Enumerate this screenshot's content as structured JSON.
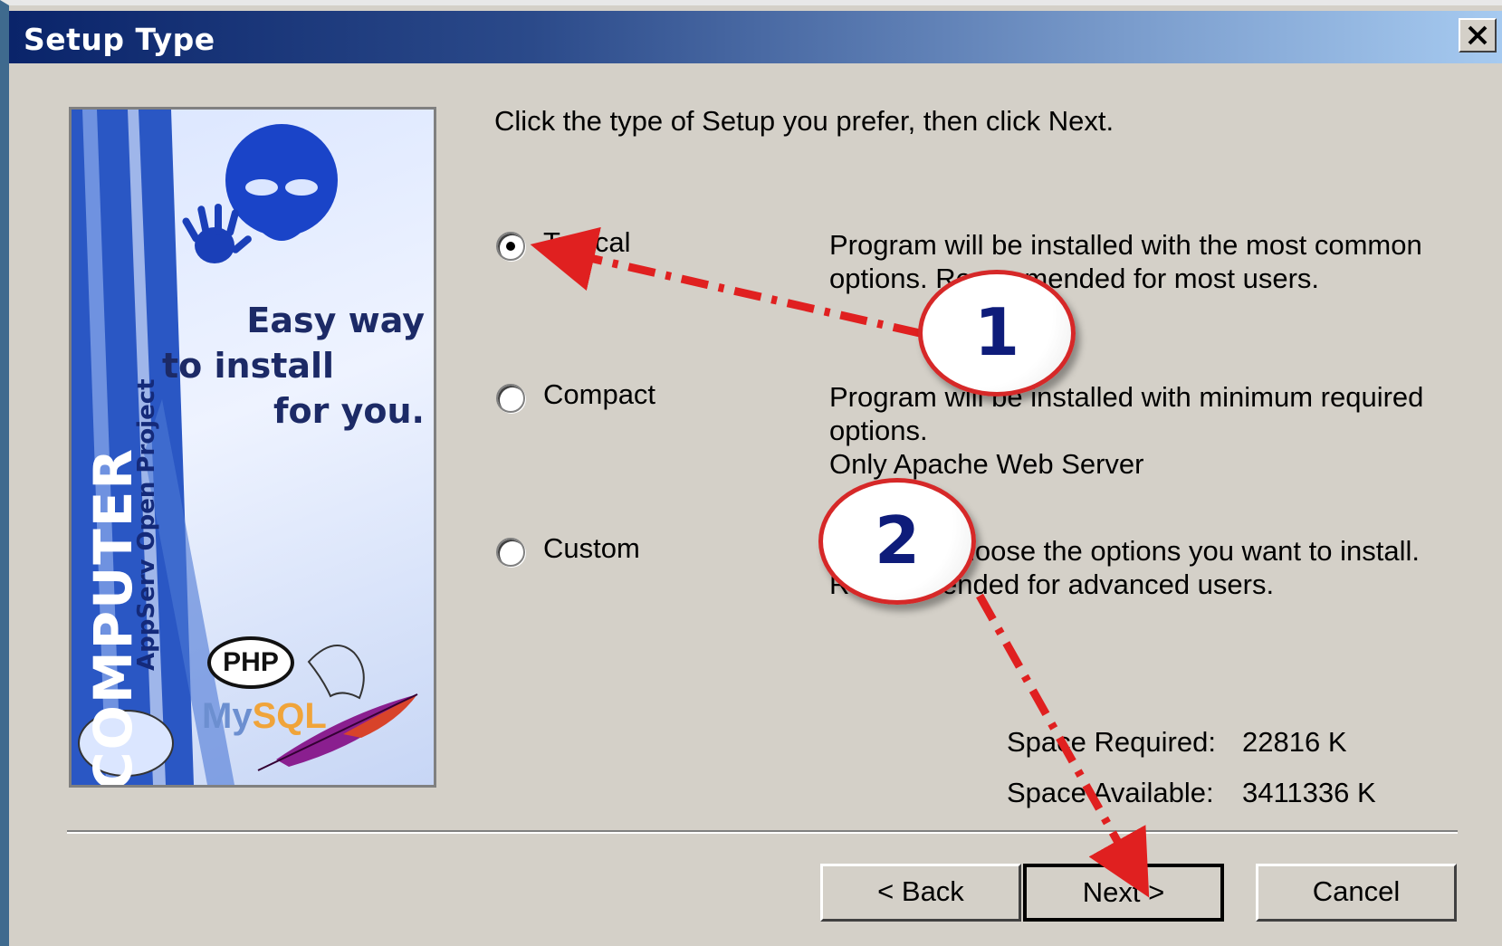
{
  "window": {
    "title": "Setup Type"
  },
  "banner": {
    "slogan_lines": [
      "Easy way",
      "to install",
      "for you."
    ],
    "brand_word": "COMPUTER",
    "project_line": "AppServ Open Project",
    "php_badge": "PHP",
    "mysql_my": "My",
    "mysql_sql": "SQL"
  },
  "instruction": "Click the type of Setup you prefer, then click Next.",
  "options": [
    {
      "label": "Typical",
      "selected": true,
      "description": [
        "Program will be installed with the most common",
        "options. Recommended for most users."
      ]
    },
    {
      "label": "Compact",
      "selected": false,
      "description": [
        "Program will be installed with minimum required",
        "options.",
        "Only Apache Web Server"
      ]
    },
    {
      "label": "Custom",
      "selected": false,
      "description": [
        "You may choose the options you want to install.",
        "Recommended for advanced users."
      ]
    }
  ],
  "space": {
    "required_label": "Space Required:",
    "required_value": "22816 K",
    "available_label": "Space Available:",
    "available_value": "3411336 K"
  },
  "buttons": {
    "back": "< Back",
    "next": "Next >",
    "cancel": "Cancel"
  },
  "annotations": {
    "step1": "1",
    "step2": "2",
    "arrow_color": "#e02020"
  },
  "colors": {
    "titlebar_start": "#0a246a",
    "titlebar_end": "#a6caf0",
    "dialog_bg": "#d4d0c8"
  }
}
